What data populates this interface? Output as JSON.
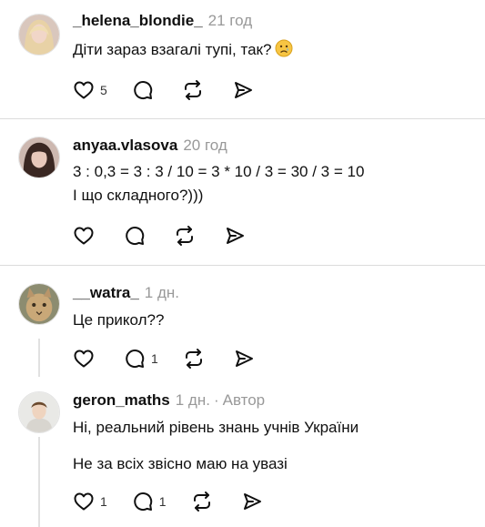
{
  "comments": [
    {
      "username": "_helena_blondie_",
      "time": "21 год",
      "lines": [
        "Діти зараз взагалі тупі, так?"
      ],
      "emoji": "sad-face",
      "likes": "5",
      "replies": "",
      "avatar": "blonde-woman"
    },
    {
      "username": "anyaa.vlasova",
      "time": "20 год",
      "lines": [
        "3 : 0,3 = 3 : 3 / 10 = 3 * 10 / 3 = 30 / 3 = 10",
        "І що складного?)))"
      ],
      "likes": "",
      "replies": "",
      "avatar": "dark-haired-woman"
    },
    {
      "username": "__watra_",
      "time": "1 дн.",
      "lines": [
        "Це прикол??"
      ],
      "likes": "",
      "replies": "1",
      "avatar": "cat"
    },
    {
      "username": "geron_maths",
      "time": "1 дн.",
      "separator": "·",
      "author_badge": "Автор",
      "lines": [
        "Ні, реальний рівень знань учнів України",
        "Не за всіх звісно маю на увазі"
      ],
      "likes": "1",
      "replies": "1",
      "avatar": "boy"
    }
  ],
  "icons": [
    "heart-icon",
    "comment-icon",
    "repost-icon",
    "share-icon"
  ],
  "colors": {
    "text": "#101010",
    "muted": "#999999",
    "divider": "#dcdcdc"
  }
}
